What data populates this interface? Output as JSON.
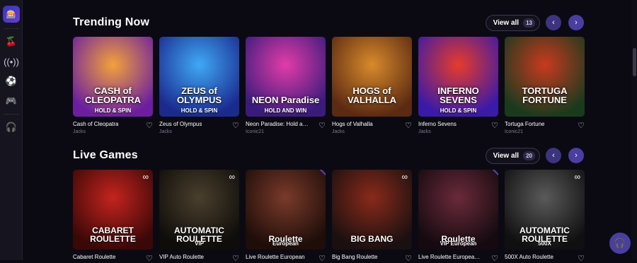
{
  "sidebar": {
    "logo_icon": "casino-logo-icon",
    "items": [
      {
        "icon": "cherries-icon",
        "glyph": "🍒"
      },
      {
        "icon": "live-broadcast-icon",
        "glyph": "((•))"
      },
      {
        "icon": "soccer-ball-icon",
        "glyph": "⚽"
      },
      {
        "icon": "gamepad-icon",
        "glyph": "🎮"
      },
      {
        "icon": "support-headset-icon",
        "glyph": "🎧"
      }
    ]
  },
  "sections": [
    {
      "title": "Trending Now",
      "view_all_label": "View all",
      "view_all_count": "13",
      "games": [
        {
          "name": "Cash of Cleopatra",
          "provider": "Jacks",
          "art_title": "CASH of CLEOPATRA",
          "art_sub": "HOLD & SPIN",
          "colors": [
            "#f3a13b",
            "#6b1fa0"
          ]
        },
        {
          "name": "Zeus of Olympus",
          "provider": "Jacks",
          "art_title": "ZEUS of OLYMPUS",
          "art_sub": "HOLD & SPIN",
          "colors": [
            "#3fa9f5",
            "#1b2a8f"
          ]
        },
        {
          "name": "Neon Paradise: Hold and...",
          "provider": "Iconic21",
          "art_title": "NEON Paradise",
          "art_sub": "HOLD AND WIN",
          "colors": [
            "#e23ca8",
            "#3a1b7c"
          ]
        },
        {
          "name": "Hogs of Valhalla",
          "provider": "Jacks",
          "art_title": "HOGS of VALHALLA",
          "art_sub": "",
          "colors": [
            "#d98a2b",
            "#5a2a12"
          ]
        },
        {
          "name": "Inferno Sevens",
          "provider": "Jacks",
          "art_title": "INFERNO SEVENS",
          "art_sub": "HOLD & SPIN",
          "colors": [
            "#e73b2a",
            "#3a1aa8"
          ]
        },
        {
          "name": "Tortuga Fortune",
          "provider": "Iconic21",
          "art_title": "TORTUGA FORTUNE",
          "art_sub": "",
          "colors": [
            "#c83a1f",
            "#1a3a1e"
          ]
        }
      ]
    },
    {
      "title": "Live Games",
      "view_all_label": "View all",
      "view_all_count": "20",
      "games": [
        {
          "name": "Cabaret Roulette",
          "art_title": "CABARET ROULETTE",
          "art_sub": "",
          "badge": "∞",
          "colors": [
            "#c4241e",
            "#3b0808"
          ]
        },
        {
          "name": "VIP Auto Roulette",
          "art_title": "AUTOMATIC ROULETTE",
          "art_sub": "VIP",
          "badge": "∞",
          "colors": [
            "#4a3f2d",
            "#0f0d0a"
          ]
        },
        {
          "name": "Live Roulette European",
          "art_title": "Roulette",
          "art_sub": "European",
          "ribbon": true,
          "colors": [
            "#7a3a2a",
            "#1e0d09"
          ]
        },
        {
          "name": "Big Bang Roulette",
          "art_title": "BIG BANG",
          "art_sub": "",
          "badge": "∞",
          "colors": [
            "#8a2a1a",
            "#1a1010"
          ]
        },
        {
          "name": "Live Roulette European ...",
          "art_title": "Roulette",
          "art_sub": "VIP European",
          "ribbon": true,
          "colors": [
            "#6a2a3a",
            "#150a10"
          ]
        },
        {
          "name": "500X Auto Roulette",
          "art_title": "AUTOMATIC ROULETTE",
          "art_sub": "500X",
          "badge": "∞",
          "colors": [
            "#5a5a5a",
            "#101010"
          ]
        }
      ]
    }
  ],
  "chat_icon": "support-chat-icon"
}
